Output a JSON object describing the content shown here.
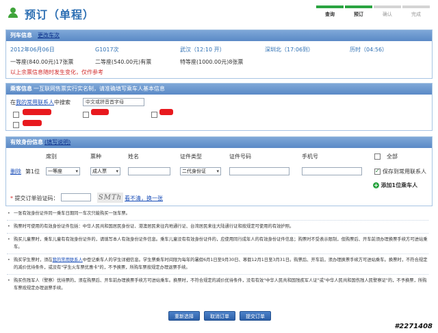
{
  "header": {
    "title": "预订（单程）",
    "steps": [
      {
        "label": "查询",
        "done": true
      },
      {
        "label": "预订",
        "done": true
      },
      {
        "label": "确认",
        "done": false
      },
      {
        "label": "完成",
        "done": false
      }
    ]
  },
  "train": {
    "section_title": "列车信息",
    "change_link": "更改车次",
    "date": "2012年06月06日",
    "train_no": "G1017次",
    "from": "武汉（12:10 开）",
    "to": "深圳北（17:06到）",
    "duration": "历时（04:56）",
    "seats": [
      "一等座(840.00元)17张票",
      "二等座(540.00元)有票",
      "特等座(1000.00元)8张票"
    ],
    "note": "以上余票信息随时发生变化，仅作参考"
  },
  "passenger": {
    "section_title": "乘客信息",
    "section_subtitle": "一互联网售票实行实名制，请准确填写乘车人基本信息",
    "search_prefix": "在",
    "search_link": "我的常用联系人",
    "search_suffix": "中搜索",
    "search_placeholder": "中文或拼音首字母"
  },
  "id_info": {
    "section_title": "有效身份信息",
    "help_link": "(填写说明)",
    "columns": [
      "席别",
      "票种",
      "姓名",
      "证件类型",
      "证件号码",
      "手机号",
      "全部"
    ],
    "row": {
      "delete": "删除",
      "seq": "第1位",
      "seat": "一等座",
      "ticket_type": "成人票",
      "id_type": "二代身份证",
      "save_label": "保存到常用联系人"
    },
    "add_label": "添加1位乘车人"
  },
  "captcha": {
    "label_star": "*",
    "label": "提交订单验证码：",
    "image_text": "SMTh",
    "refresh_link": "看不清，换一张"
  },
  "notes": [
    "一张有效身份证件同一乘车日期同一车次只能购买一张车票。",
    "购票时可使用的有效身份证件包括：中华人民共和国居民身份证、港澳居民来往内地通行证、台湾居民来往大陆通行证和按规定可使用的有效护照。",
    "购买儿童票时，乘车儿童有有效身份证件的，请填写本人有效身份证件信息。乘车儿童没有有效身份证件的，应使用同行成年人的有效身份证件信息；购票时不受表示限制，但购票后、开车前须办理换票手续方可进站乘车。",
    "购买学生票时，须在",
    "我的常用联系人",
    "中登记乘车人的学生详细信息。学生票乘车时间限为每年的暑假6月1日至9月30日、寒假12月1日至3月31日。购票后、开车前，须办理换票手续方可进站乘车。换票时，不符合规定的减价优待条件，或没有\"学生火车票优惠卡\"的，不予换票，所购车票按规定办理退票手续。",
    "购买伤残军人（警察）优待票的，须在购票后、开车前办理换票手续方可进站乘车。换票时，不符合规定的减价优待条件，没有有效\"中华人民共和国残疾军人证\"或\"中华人民共和国伤残人民警察证\"的，不予换票，所购车票按规定办理退票手续。"
  ],
  "buttons": {
    "reselect": "重新选择",
    "cancel": "取消订单",
    "submit": "提交订单"
  },
  "watermark": "#2271408",
  "colors": {
    "header_blue": "#5a89c6",
    "title_blue": "#2d6fb3",
    "green": "#2aa441",
    "red": "#d12b2b"
  }
}
